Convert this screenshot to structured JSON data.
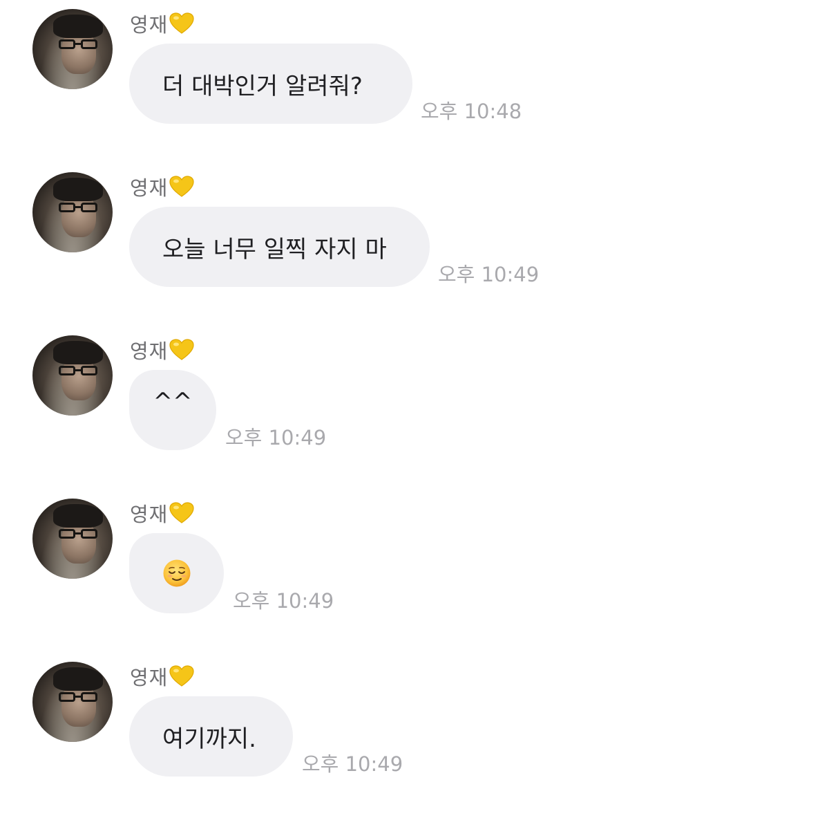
{
  "messages": [
    {
      "sender": "영재",
      "sender_badge": "yellow-heart-icon",
      "text": "더 대박인거 알려줘?",
      "time": "오후 10:48"
    },
    {
      "sender": "영재",
      "sender_badge": "yellow-heart-icon",
      "text": "오늘 너무 일찍 자지 마",
      "time": "오후 10:49"
    },
    {
      "sender": "영재",
      "sender_badge": "yellow-heart-icon",
      "text": "^^",
      "time": "오후 10:49"
    },
    {
      "sender": "영재",
      "sender_badge": "yellow-heart-icon",
      "text": "",
      "emoji": "relieved-face-icon",
      "time": "오후 10:49"
    },
    {
      "sender": "영재",
      "sender_badge": "yellow-heart-icon",
      "text": "여기까지.",
      "time": "오후 10:49"
    }
  ],
  "colors": {
    "bubble_background": "#f0f0f3",
    "message_text": "#1f1f22",
    "sender_text": "#6f6f72",
    "time_text": "#a9a9ad",
    "heart": "#f5c518"
  }
}
